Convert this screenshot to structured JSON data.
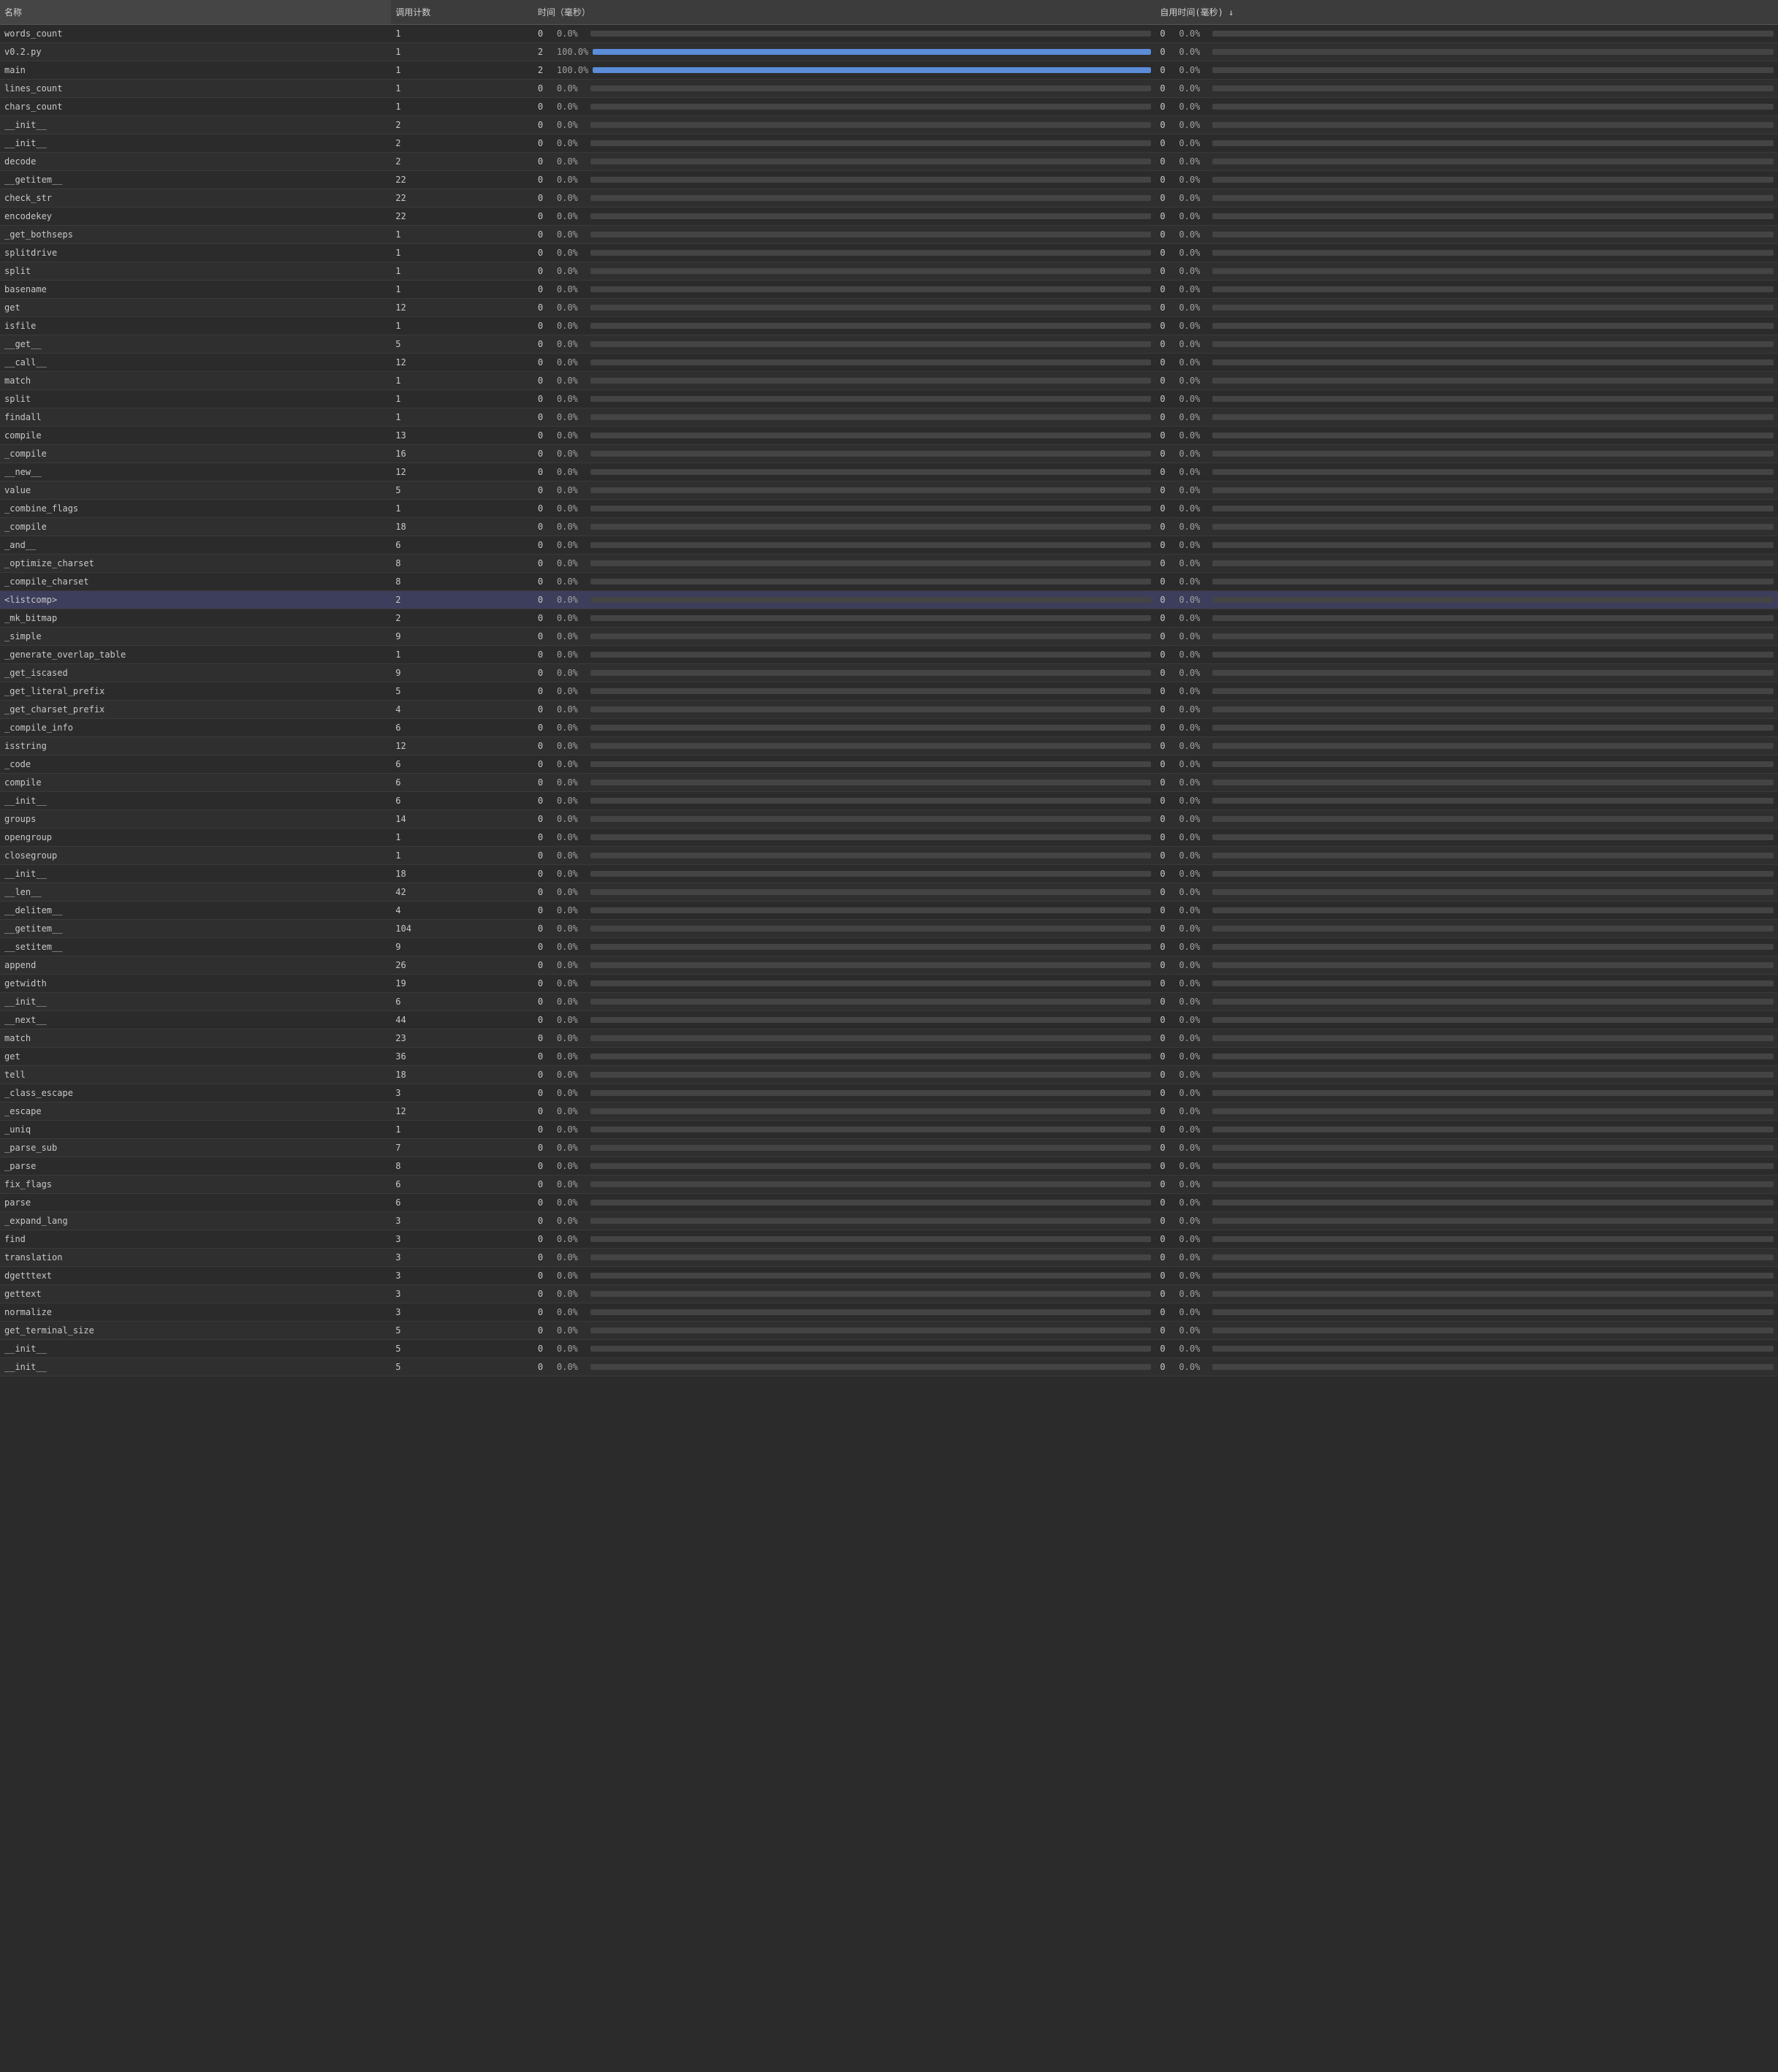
{
  "headers": {
    "name": "名称",
    "calls": "调用计数",
    "time": "时间（毫秒）",
    "selftime": "自用时间(毫秒) ↓"
  },
  "rows": [
    {
      "name": "words_count",
      "calls": 1,
      "time": 0,
      "time_pct": "0.0%",
      "selftime": 0,
      "selftime_pct": "0.0%",
      "highlight": false
    },
    {
      "name": "v0.2.py",
      "calls": 1,
      "time": 2,
      "time_pct": "100.0%",
      "selftime": 0,
      "selftime_pct": "0.0%",
      "highlight": false
    },
    {
      "name": "main",
      "calls": 1,
      "time": 2,
      "time_pct": "100.0%",
      "selftime": 0,
      "selftime_pct": "0.0%",
      "highlight": false
    },
    {
      "name": "lines_count",
      "calls": 1,
      "time": 0,
      "time_pct": "0.0%",
      "selftime": 0,
      "selftime_pct": "0.0%",
      "highlight": false
    },
    {
      "name": "chars_count",
      "calls": 1,
      "time": 0,
      "time_pct": "0.0%",
      "selftime": 0,
      "selftime_pct": "0.0%",
      "highlight": false
    },
    {
      "name": "__init__",
      "calls": 2,
      "time": 0,
      "time_pct": "0.0%",
      "selftime": 0,
      "selftime_pct": "0.0%",
      "highlight": false
    },
    {
      "name": "__init__",
      "calls": 2,
      "time": 0,
      "time_pct": "0.0%",
      "selftime": 0,
      "selftime_pct": "0.0%",
      "highlight": false
    },
    {
      "name": "decode",
      "calls": 2,
      "time": 0,
      "time_pct": "0.0%",
      "selftime": 0,
      "selftime_pct": "0.0%",
      "highlight": false
    },
    {
      "name": "__getitem__",
      "calls": 22,
      "time": 0,
      "time_pct": "0.0%",
      "selftime": 0,
      "selftime_pct": "0.0%",
      "highlight": false
    },
    {
      "name": "check_str",
      "calls": 22,
      "time": 0,
      "time_pct": "0.0%",
      "selftime": 0,
      "selftime_pct": "0.0%",
      "highlight": false
    },
    {
      "name": "encodekey",
      "calls": 22,
      "time": 0,
      "time_pct": "0.0%",
      "selftime": 0,
      "selftime_pct": "0.0%",
      "highlight": false
    },
    {
      "name": "_get_bothseps",
      "calls": 1,
      "time": 0,
      "time_pct": "0.0%",
      "selftime": 0,
      "selftime_pct": "0.0%",
      "highlight": false
    },
    {
      "name": "splitdrive",
      "calls": 1,
      "time": 0,
      "time_pct": "0.0%",
      "selftime": 0,
      "selftime_pct": "0.0%",
      "highlight": false
    },
    {
      "name": "split",
      "calls": 1,
      "time": 0,
      "time_pct": "0.0%",
      "selftime": 0,
      "selftime_pct": "0.0%",
      "highlight": false
    },
    {
      "name": "basename",
      "calls": 1,
      "time": 0,
      "time_pct": "0.0%",
      "selftime": 0,
      "selftime_pct": "0.0%",
      "highlight": false
    },
    {
      "name": "get",
      "calls": 12,
      "time": 0,
      "time_pct": "0.0%",
      "selftime": 0,
      "selftime_pct": "0.0%",
      "highlight": false
    },
    {
      "name": "isfile",
      "calls": 1,
      "time": 0,
      "time_pct": "0.0%",
      "selftime": 0,
      "selftime_pct": "0.0%",
      "highlight": false
    },
    {
      "name": "__get__",
      "calls": 5,
      "time": 0,
      "time_pct": "0.0%",
      "selftime": 0,
      "selftime_pct": "0.0%",
      "highlight": false
    },
    {
      "name": "__call__",
      "calls": 12,
      "time": 0,
      "time_pct": "0.0%",
      "selftime": 0,
      "selftime_pct": "0.0%",
      "highlight": false
    },
    {
      "name": "match",
      "calls": 1,
      "time": 0,
      "time_pct": "0.0%",
      "selftime": 0,
      "selftime_pct": "0.0%",
      "highlight": false
    },
    {
      "name": "split",
      "calls": 1,
      "time": 0,
      "time_pct": "0.0%",
      "selftime": 0,
      "selftime_pct": "0.0%",
      "highlight": false
    },
    {
      "name": "findall",
      "calls": 1,
      "time": 0,
      "time_pct": "0.0%",
      "selftime": 0,
      "selftime_pct": "0.0%",
      "highlight": false
    },
    {
      "name": "compile",
      "calls": 13,
      "time": 0,
      "time_pct": "0.0%",
      "selftime": 0,
      "selftime_pct": "0.0%",
      "highlight": false
    },
    {
      "name": "_compile",
      "calls": 16,
      "time": 0,
      "time_pct": "0.0%",
      "selftime": 0,
      "selftime_pct": "0.0%",
      "highlight": false
    },
    {
      "name": "__new__",
      "calls": 12,
      "time": 0,
      "time_pct": "0.0%",
      "selftime": 0,
      "selftime_pct": "0.0%",
      "highlight": false
    },
    {
      "name": "value",
      "calls": 5,
      "time": 0,
      "time_pct": "0.0%",
      "selftime": 0,
      "selftime_pct": "0.0%",
      "highlight": false
    },
    {
      "name": "_combine_flags",
      "calls": 1,
      "time": 0,
      "time_pct": "0.0%",
      "selftime": 0,
      "selftime_pct": "0.0%",
      "highlight": false
    },
    {
      "name": "_compile",
      "calls": 18,
      "time": 0,
      "time_pct": "0.0%",
      "selftime": 0,
      "selftime_pct": "0.0%",
      "highlight": false
    },
    {
      "name": "_and__",
      "calls": 6,
      "time": 0,
      "time_pct": "0.0%",
      "selftime": 0,
      "selftime_pct": "0.0%",
      "highlight": false
    },
    {
      "name": "_optimize_charset",
      "calls": 8,
      "time": 0,
      "time_pct": "0.0%",
      "selftime": 0,
      "selftime_pct": "0.0%",
      "highlight": false
    },
    {
      "name": "_compile_charset",
      "calls": 8,
      "time": 0,
      "time_pct": "0.0%",
      "selftime": 0,
      "selftime_pct": "0.0%",
      "highlight": false
    },
    {
      "name": "<listcomp>",
      "calls": 2,
      "time": 0,
      "time_pct": "0.0%",
      "selftime": 0,
      "selftime_pct": "0.0%",
      "highlight": true
    },
    {
      "name": "_mk_bitmap",
      "calls": 2,
      "time": 0,
      "time_pct": "0.0%",
      "selftime": 0,
      "selftime_pct": "0.0%",
      "highlight": false
    },
    {
      "name": "_simple",
      "calls": 9,
      "time": 0,
      "time_pct": "0.0%",
      "selftime": 0,
      "selftime_pct": "0.0%",
      "highlight": false
    },
    {
      "name": "_generate_overlap_table",
      "calls": 1,
      "time": 0,
      "time_pct": "0.0%",
      "selftime": 0,
      "selftime_pct": "0.0%",
      "highlight": false
    },
    {
      "name": "_get_iscased",
      "calls": 9,
      "time": 0,
      "time_pct": "0.0%",
      "selftime": 0,
      "selftime_pct": "0.0%",
      "highlight": false
    },
    {
      "name": "_get_literal_prefix",
      "calls": 5,
      "time": 0,
      "time_pct": "0.0%",
      "selftime": 0,
      "selftime_pct": "0.0%",
      "highlight": false
    },
    {
      "name": "_get_charset_prefix",
      "calls": 4,
      "time": 0,
      "time_pct": "0.0%",
      "selftime": 0,
      "selftime_pct": "0.0%",
      "highlight": false
    },
    {
      "name": "_compile_info",
      "calls": 6,
      "time": 0,
      "time_pct": "0.0%",
      "selftime": 0,
      "selftime_pct": "0.0%",
      "highlight": false
    },
    {
      "name": "isstring",
      "calls": 12,
      "time": 0,
      "time_pct": "0.0%",
      "selftime": 0,
      "selftime_pct": "0.0%",
      "highlight": false
    },
    {
      "name": "_code",
      "calls": 6,
      "time": 0,
      "time_pct": "0.0%",
      "selftime": 0,
      "selftime_pct": "0.0%",
      "highlight": false
    },
    {
      "name": "compile",
      "calls": 6,
      "time": 0,
      "time_pct": "0.0%",
      "selftime": 0,
      "selftime_pct": "0.0%",
      "highlight": false
    },
    {
      "name": "__init__",
      "calls": 6,
      "time": 0,
      "time_pct": "0.0%",
      "selftime": 0,
      "selftime_pct": "0.0%",
      "highlight": false
    },
    {
      "name": "groups",
      "calls": 14,
      "time": 0,
      "time_pct": "0.0%",
      "selftime": 0,
      "selftime_pct": "0.0%",
      "highlight": false
    },
    {
      "name": "opengroup",
      "calls": 1,
      "time": 0,
      "time_pct": "0.0%",
      "selftime": 0,
      "selftime_pct": "0.0%",
      "highlight": false
    },
    {
      "name": "closegroup",
      "calls": 1,
      "time": 0,
      "time_pct": "0.0%",
      "selftime": 0,
      "selftime_pct": "0.0%",
      "highlight": false
    },
    {
      "name": "__init__",
      "calls": 18,
      "time": 0,
      "time_pct": "0.0%",
      "selftime": 0,
      "selftime_pct": "0.0%",
      "highlight": false
    },
    {
      "name": "__len__",
      "calls": 42,
      "time": 0,
      "time_pct": "0.0%",
      "selftime": 0,
      "selftime_pct": "0.0%",
      "highlight": false
    },
    {
      "name": "__delitem__",
      "calls": 4,
      "time": 0,
      "time_pct": "0.0%",
      "selftime": 0,
      "selftime_pct": "0.0%",
      "highlight": false
    },
    {
      "name": "__getitem__",
      "calls": 104,
      "time": 0,
      "time_pct": "0.0%",
      "selftime": 0,
      "selftime_pct": "0.0%",
      "highlight": false
    },
    {
      "name": "__setitem__",
      "calls": 9,
      "time": 0,
      "time_pct": "0.0%",
      "selftime": 0,
      "selftime_pct": "0.0%",
      "highlight": false
    },
    {
      "name": "append",
      "calls": 26,
      "time": 0,
      "time_pct": "0.0%",
      "selftime": 0,
      "selftime_pct": "0.0%",
      "highlight": false
    },
    {
      "name": "getwidth",
      "calls": 19,
      "time": 0,
      "time_pct": "0.0%",
      "selftime": 0,
      "selftime_pct": "0.0%",
      "highlight": false
    },
    {
      "name": "__init__",
      "calls": 6,
      "time": 0,
      "time_pct": "0.0%",
      "selftime": 0,
      "selftime_pct": "0.0%",
      "highlight": false
    },
    {
      "name": "__next__",
      "calls": 44,
      "time": 0,
      "time_pct": "0.0%",
      "selftime": 0,
      "selftime_pct": "0.0%",
      "highlight": false
    },
    {
      "name": "match",
      "calls": 23,
      "time": 0,
      "time_pct": "0.0%",
      "selftime": 0,
      "selftime_pct": "0.0%",
      "highlight": false
    },
    {
      "name": "get",
      "calls": 36,
      "time": 0,
      "time_pct": "0.0%",
      "selftime": 0,
      "selftime_pct": "0.0%",
      "highlight": false
    },
    {
      "name": "tell",
      "calls": 18,
      "time": 0,
      "time_pct": "0.0%",
      "selftime": 0,
      "selftime_pct": "0.0%",
      "highlight": false
    },
    {
      "name": "_class_escape",
      "calls": 3,
      "time": 0,
      "time_pct": "0.0%",
      "selftime": 0,
      "selftime_pct": "0.0%",
      "highlight": false
    },
    {
      "name": "_escape",
      "calls": 12,
      "time": 0,
      "time_pct": "0.0%",
      "selftime": 0,
      "selftime_pct": "0.0%",
      "highlight": false
    },
    {
      "name": "_uniq",
      "calls": 1,
      "time": 0,
      "time_pct": "0.0%",
      "selftime": 0,
      "selftime_pct": "0.0%",
      "highlight": false
    },
    {
      "name": "_parse_sub",
      "calls": 7,
      "time": 0,
      "time_pct": "0.0%",
      "selftime": 0,
      "selftime_pct": "0.0%",
      "highlight": false
    },
    {
      "name": "_parse",
      "calls": 8,
      "time": 0,
      "time_pct": "0.0%",
      "selftime": 0,
      "selftime_pct": "0.0%",
      "highlight": false
    },
    {
      "name": "fix_flags",
      "calls": 6,
      "time": 0,
      "time_pct": "0.0%",
      "selftime": 0,
      "selftime_pct": "0.0%",
      "highlight": false
    },
    {
      "name": "parse",
      "calls": 6,
      "time": 0,
      "time_pct": "0.0%",
      "selftime": 0,
      "selftime_pct": "0.0%",
      "highlight": false
    },
    {
      "name": "_expand_lang",
      "calls": 3,
      "time": 0,
      "time_pct": "0.0%",
      "selftime": 0,
      "selftime_pct": "0.0%",
      "highlight": false
    },
    {
      "name": "find",
      "calls": 3,
      "time": 0,
      "time_pct": "0.0%",
      "selftime": 0,
      "selftime_pct": "0.0%",
      "highlight": false
    },
    {
      "name": "translation",
      "calls": 3,
      "time": 0,
      "time_pct": "0.0%",
      "selftime": 0,
      "selftime_pct": "0.0%",
      "highlight": false
    },
    {
      "name": "dgetttext",
      "calls": 3,
      "time": 0,
      "time_pct": "0.0%",
      "selftime": 0,
      "selftime_pct": "0.0%",
      "highlight": false
    },
    {
      "name": "gettext",
      "calls": 3,
      "time": 0,
      "time_pct": "0.0%",
      "selftime": 0,
      "selftime_pct": "0.0%",
      "highlight": false
    },
    {
      "name": "normalize",
      "calls": 3,
      "time": 0,
      "time_pct": "0.0%",
      "selftime": 0,
      "selftime_pct": "0.0%",
      "highlight": false
    },
    {
      "name": "get_terminal_size",
      "calls": 5,
      "time": 0,
      "time_pct": "0.0%",
      "selftime": 0,
      "selftime_pct": "0.0%",
      "highlight": false
    },
    {
      "name": "__init__",
      "calls": 5,
      "time": 0,
      "time_pct": "0.0%",
      "selftime": 0,
      "selftime_pct": "0.0%",
      "highlight": false
    },
    {
      "name": "__init__",
      "calls": 5,
      "time": 0,
      "time_pct": "0.0%",
      "selftime": 0,
      "selftime_pct": "0.0%",
      "highlight": false
    }
  ]
}
